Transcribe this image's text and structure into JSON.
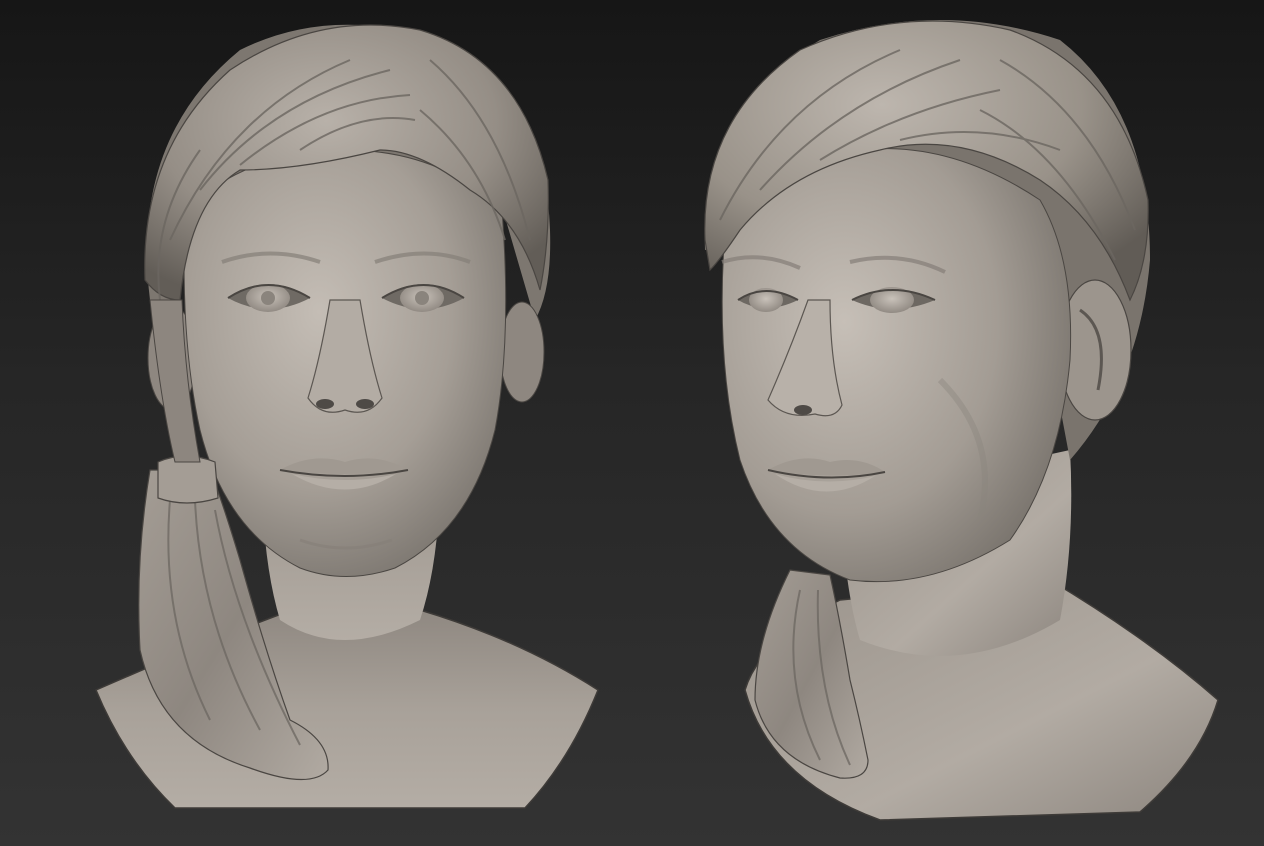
{
  "scene": {
    "colors": {
      "background_top": "#161616",
      "background_bottom": "#333333",
      "clay_light": "#b9b2aa",
      "clay_mid": "#9c958d",
      "clay_dark": "#6e6962",
      "shadow": "#3e3b38"
    },
    "sculpts": [
      {
        "view": "front"
      },
      {
        "view": "three-quarter"
      }
    ]
  }
}
